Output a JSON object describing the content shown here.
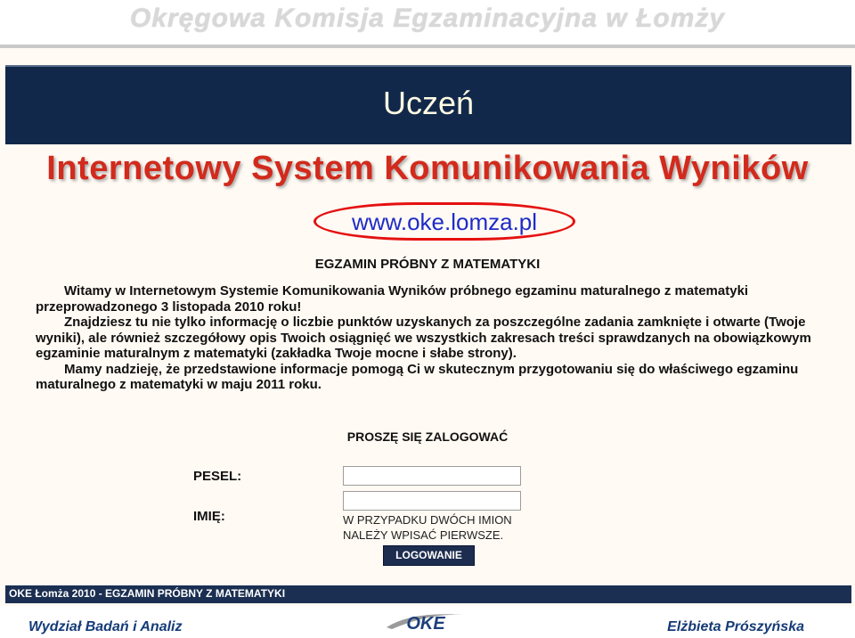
{
  "header": {
    "banner": "Okręgowa Komisja Egzaminacyjna w Łomży",
    "slide_title": "Uczeń"
  },
  "system": {
    "title": "Internetowy System Komunikowania Wyników",
    "url": "www.oke.lomza.pl"
  },
  "content": {
    "exam_heading": "EGZAMIN PRÓBNY Z MATEMATYKI",
    "paragraph1": "Witamy w Internetowym Systemie Komunikowania Wyników próbnego egzaminu maturalnego z matematyki przeprowadzonego 3 listopada 2010 roku!",
    "paragraph2": "Znajdziesz tu nie tylko informację o liczbie punktów uzyskanych za poszczególne zadania zamknięte i otwarte (Twoje wyniki), ale również szczegółowy opis Twoich osiągnięć we wszystkich zakresach treści sprawdzanych na obowiązkowym egzaminie maturalnym z matematyki (zakładka Twoje mocne i słabe strony).",
    "paragraph3": "Mamy nadzieję, że przedstawione informacje pomogą Ci w skutecznym przygotowaniu się do właściwego egzaminu maturalnego z matematyki w maju 2011 roku."
  },
  "login": {
    "heading": "PROSZĘ SIĘ ZALOGOWAĆ",
    "pesel_label": "PESEL:",
    "pesel_value": "",
    "name_label": "IMIĘ:",
    "name_value": "",
    "hint_line1": "W PRZYPADKU DWÓCH IMION",
    "hint_line2": "NALEŻY WPISAĆ PIERWSZE.",
    "button_label": "LOGOWANIE"
  },
  "status_bar": {
    "text": "OKE Łomża 2010 - EGZAMIN PRÓBNY Z MATEMATYKI"
  },
  "footer": {
    "left": "Wydział Badań i Analiz",
    "logo_text": "OKE",
    "right": "Elżbieta Prószyńska"
  }
}
